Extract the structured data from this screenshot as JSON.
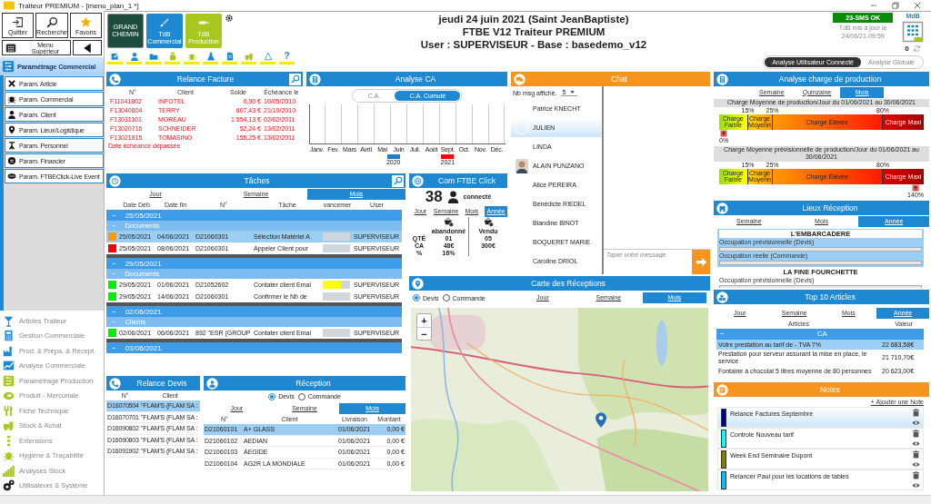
{
  "window": {
    "title": "Traiteur PREMIUM - [menu_plan_1 *]"
  },
  "sidebar": {
    "top_buttons": [
      "Quitter",
      "Recherche",
      "Favoris"
    ],
    "menu_button": "Menu Supérieur",
    "section": {
      "label": "Paramétrage Commercial",
      "expanded": true,
      "items": [
        {
          "label": "Param. Article",
          "selected": false
        },
        {
          "label": "Param. Commercial",
          "selected": false
        },
        {
          "label": "Param. Client",
          "selected": false
        },
        {
          "label": "Param. Lieux/Logistique",
          "selected": false
        },
        {
          "label": "Param. Personnel",
          "selected": false
        },
        {
          "label": "Param. Financier",
          "selected": false
        },
        {
          "label": "Param. FTBEClick-Live Event",
          "selected": false
        }
      ]
    },
    "modules": [
      {
        "label": "Articles Traiteur",
        "color": "#1e88d2"
      },
      {
        "label": "Gestion Commerciale",
        "color": "#1e88d2"
      },
      {
        "label": "Prod. & Prépa. & Récept.",
        "color": "#1e88d2"
      },
      {
        "label": "Analyse Commerciale",
        "color": "#1e88d2"
      },
      {
        "label": "Paramétrage Production",
        "color": "#a8c820"
      },
      {
        "label": "Produit - Mercuriale",
        "color": "#a8c820"
      },
      {
        "label": "Fiche Technique",
        "color": "#a8c820"
      },
      {
        "label": "Stock & Achat",
        "color": "#a8c820"
      },
      {
        "label": "Extensions",
        "color": "#a8c820"
      },
      {
        "label": "Hygiène & Traçabilité",
        "color": "#a8c820"
      },
      {
        "label": "Analyses Stock",
        "color": "#a8c820"
      },
      {
        "label": "Utilisateurs & Système",
        "color": "#222222"
      }
    ]
  },
  "header": {
    "tiles": [
      {
        "kind": "logo",
        "label": "GRAND CHEMIN"
      },
      {
        "kind": "commercial",
        "label": "TdB Commercial"
      },
      {
        "kind": "production",
        "label": "TdB Production"
      }
    ],
    "help": "?",
    "title_lines": [
      "jeudi 24 juin 2021  (Saint JeanBaptiste)",
      "FTBE V12 Traiteur PREMIUM",
      "User : SUPERVISEUR - Base : basedemo_v12"
    ],
    "sms_status": "23-SMS OK",
    "update_label": "TdB mis à jour le",
    "update_time": "24/06/21-09:59",
    "counter": "0",
    "brand": "MdB",
    "analysis_toggle": [
      {
        "label": "Analyse Utilisateur Connecté",
        "selected": true
      },
      {
        "label": "Analyse Globale",
        "selected": false
      }
    ]
  },
  "relance_facture": {
    "title": "Relance Facture",
    "columns": [
      "N°",
      "Client",
      "Solde",
      "Échéance le"
    ],
    "rows": [
      {
        "cells": [
          "F11041802",
          "INFOTEL",
          "0,90 €",
          "10/05/2010"
        ],
        "overdue": true
      },
      {
        "cells": [
          "F13040804",
          "TERRY",
          "607,43 €",
          "21/10/2010"
        ],
        "overdue": true
      },
      {
        "cells": [
          "F13031101",
          "MOREAU",
          "1 554,13 €",
          "02/02/2011"
        ],
        "overdue": true
      },
      {
        "cells": [
          "F13020716",
          "SCHNEIDER",
          "52,24 €",
          "13/02/2011"
        ],
        "overdue": true
      },
      {
        "cells": [
          "F13021815",
          "TOMASINO",
          "155,25 €",
          "13/02/2011"
        ],
        "overdue": true
      }
    ],
    "note": "Date échéance dépassée"
  },
  "analyse_ca": {
    "title": "Analyse CA",
    "toggle": [
      {
        "label": "C.A.",
        "selected": false
      },
      {
        "label": "C.A. Cumulé",
        "selected": true
      }
    ],
    "months": [
      "Janv.",
      "Fev.",
      "Mars",
      "Avril",
      "Mai",
      "Juin",
      "Juil.",
      "Août",
      "Sept.",
      "Oct.",
      "Nov.",
      "Déc."
    ],
    "legend": [
      {
        "label": "2020",
        "color": "#1e7fc8"
      },
      {
        "label": "2021",
        "color": "#ff0000"
      }
    ]
  },
  "taches": {
    "title": "Tâches",
    "tabs": [
      {
        "label": "Jour",
        "selected": false
      },
      {
        "label": "Semaine",
        "selected": false
      },
      {
        "label": "Mois",
        "selected": true
      }
    ],
    "columns": [
      "Date Déb.",
      "Date fin",
      "N°",
      "Tâche",
      "vancemer",
      "User"
    ],
    "groups": [
      {
        "toggle": "−",
        "date": "25/05/2021",
        "subgroups": [
          {
            "toggle": "−",
            "label": "Documents",
            "rows": [
              {
                "color": "#ff9900",
                "start": "25/05/2021",
                "end": "04/06/2021",
                "number": "D21060301",
                "task": "Sélection Matériel A",
                "level": 0,
                "user": "SUPERVISEUR",
                "selected": true
              },
              {
                "color": "#ff0000",
                "start": "25/05/2021",
                "end": "08/06/2021",
                "number": "D21060301",
                "task": "Appeler Client pour",
                "level": 0,
                "user": "SUPERVISEUR",
                "selected": false
              }
            ]
          }
        ]
      },
      {
        "toggle": "−",
        "date": "29/05/2021",
        "subgroups": [
          {
            "toggle": "−",
            "label": "Documents",
            "rows": [
              {
                "color": "#00ee00",
                "start": "29/05/2021",
                "end": "01/06/2021",
                "number": "D21052602",
                "task": "Contater client Emai",
                "level": 0.68,
                "user": "SUPERVISEUR",
                "selected": false
              },
              {
                "color": "#00ee00",
                "start": "29/05/2021",
                "end": "14/06/2021",
                "number": "D21060301",
                "task": "Confirmer le Nb de",
                "level": 0,
                "user": "SUPERVISEUR",
                "selected": false
              }
            ]
          }
        ]
      },
      {
        "toggle": "−",
        "date": "02/06/2021",
        "subgroups": [
          {
            "toggle": "−",
            "label": "Clients",
            "rows": [
              {
                "color": "#00ee00",
                "start": "02/06/2021",
                "end": "06/06/2021",
                "number": "892 \"ESR (GROUP",
                "task": "Contater client Emai",
                "level": 0,
                "user": "SUPERVISEUR",
                "selected": false
              }
            ]
          }
        ]
      },
      {
        "toggle": "−",
        "date": "03/06/2021"
      }
    ]
  },
  "com_ftbe": {
    "title": "Com FTBE Click",
    "connected_count": "38",
    "connected_label": "connecté",
    "tabs": [
      {
        "label": "Jour",
        "selected": false
      },
      {
        "label": "Semaine",
        "selected": false
      },
      {
        "label": "Mois",
        "selected": false
      },
      {
        "label": "Année",
        "selected": true
      }
    ],
    "row_labels": [
      "QTÉ",
      "CA",
      "%"
    ],
    "columns": [
      {
        "label": "abandonné",
        "values": [
          "01",
          "48€",
          "16%"
        ]
      },
      {
        "label": "Vendu",
        "values": [
          "05",
          "300€"
        ]
      }
    ]
  },
  "chat": {
    "title": "Chat",
    "count_label": "Nb msg affiché.",
    "count_value": "5",
    "contacts": [
      {
        "name": "Patrice KNECHT",
        "selected": false,
        "kind": "plain"
      },
      {
        "name": "JULIEN",
        "selected": true,
        "kind": "blank"
      },
      {
        "name": "LINDA",
        "selected": false,
        "kind": "plain"
      },
      {
        "name": "ALAIN PUNZANO",
        "selected": false
      },
      {
        "name": "Alice PEREIRA",
        "selected": false,
        "kind": "plain"
      },
      {
        "name": "Bénédicte RIEDEL",
        "selected": false,
        "kind": "plain"
      },
      {
        "name": "Blandine BINOT",
        "selected": false,
        "kind": "plain"
      },
      {
        "name": "BOQUERET MARIE",
        "selected": false,
        "kind": "plain"
      },
      {
        "name": "Caroline DRIOL",
        "selected": false,
        "kind": "plain"
      }
    ],
    "message_placeholder": "Taper votre message"
  },
  "carte": {
    "title": "Carte des Réceptions",
    "radios": [
      {
        "label": "Devis",
        "selected": true
      },
      {
        "label": "Commande",
        "selected": false
      }
    ],
    "tabs": [
      {
        "label": "Jour",
        "selected": false
      },
      {
        "label": "Semaine",
        "selected": false
      },
      {
        "label": "Mois",
        "selected": true
      }
    ],
    "zoom_in": "+",
    "zoom_out": "−"
  },
  "relance_devis": {
    "title": "Relance Devis",
    "columns": [
      "N°",
      "Client"
    ],
    "rows": [
      {
        "cells": [
          "D16070504",
          "\"FLAM'S (FLAM SA :"
        ],
        "selected": true
      },
      {
        "cells": [
          "D16070701",
          "\"FLAM'S (FLAM SA :"
        ],
        "selected": false
      },
      {
        "cells": [
          "D16090802",
          "\"FLAM'S (FLAM SA :"
        ],
        "selected": false
      },
      {
        "cells": [
          "D16090803",
          "\"FLAM'S (FLAM SA :"
        ],
        "selected": false
      },
      {
        "cells": [
          "D16091902",
          "\"FLAM'S (FLAM SA :"
        ],
        "selected": false
      }
    ]
  },
  "reception": {
    "title": "Réception",
    "radios": [
      {
        "label": "Devis",
        "selected": true
      },
      {
        "label": "Commande",
        "selected": false
      }
    ],
    "tabs": [
      {
        "label": "Jour",
        "selected": false
      },
      {
        "label": "Semaine",
        "selected": false
      },
      {
        "label": "Mois",
        "selected": true
      }
    ],
    "columns": [
      "N°",
      "Client",
      "Livraison",
      "Montant"
    ],
    "rows": [
      {
        "cells": [
          "D21060101",
          "A+ GLASS",
          "01/06/2021",
          "0,00 €"
        ],
        "selected": true
      },
      {
        "cells": [
          "D21060102",
          "AEDIAN",
          "01/06/2021",
          "0,00 €"
        ],
        "selected": false
      },
      {
        "cells": [
          "D21060103",
          "AEGIDE",
          "01/06/2021",
          "0,00 €"
        ],
        "selected": false
      },
      {
        "cells": [
          "D21060104",
          "AG2R LA MONDIALE",
          "01/06/2021",
          "0,00 €"
        ],
        "selected": false
      }
    ]
  },
  "charge": {
    "title": "Analyse charge de production",
    "tabs": [
      {
        "label": "Semaine",
        "selected": false
      },
      {
        "label": "Quinzaine",
        "selected": false
      },
      {
        "label": "Mois",
        "selected": true
      }
    ],
    "gauges": [
      {
        "caption": "Charge Moyenne de production/Jour du 01/06/2021 au 30/06/2021",
        "ticks": [
          "15%",
          "25%",
          "80%"
        ],
        "zones": [
          "Charge Faible",
          "Charge Moyenn",
          "Charge Élevée",
          "Charge Maxi"
        ],
        "marker": {
          "label": "0%",
          "level": 0
        }
      },
      {
        "caption": "Charge Moyenne prévisionnelle de production/Jour du 01/06/2021 au 30/06/2021",
        "ticks": [
          "15%",
          "25%",
          "80%"
        ],
        "zones": [
          "Charge Faible",
          "Charge Moyenn",
          "Charge Élevée",
          "Charge Maxi"
        ],
        "marker": {
          "label": "140%",
          "level": 1
        }
      }
    ]
  },
  "lieux": {
    "title": "Lieux  Réception",
    "tabs": [
      {
        "label": "Semaine",
        "selected": false
      },
      {
        "label": "Mois",
        "selected": false
      },
      {
        "label": "Année",
        "selected": true
      }
    ],
    "venues": [
      {
        "name": "L'EMBARCADERE",
        "selected": true,
        "occupancy": [
          "Occupation prévisionnelle (Devis)",
          "Occupation réelle (Commande)"
        ]
      },
      {
        "name": "LA FINE FOURCHETTE",
        "selected": false,
        "occupancy": [
          "Occupation prévisionnelle (Devis)"
        ]
      }
    ]
  },
  "top10": {
    "title": "Top 10 Articles",
    "tabs": [
      {
        "label": "Jour",
        "selected": false
      },
      {
        "label": "Semaine",
        "selected": false
      },
      {
        "label": "Mois",
        "selected": false
      },
      {
        "label": "Année",
        "selected": true
      }
    ],
    "columns": [
      "Articles",
      "Valeur"
    ],
    "group": {
      "toggle": "−",
      "label": "CA"
    },
    "rows": [
      {
        "article": "Votre prestation au tarif de - TVA 7%",
        "value": "22 683,58€",
        "selected": true
      },
      {
        "article": "Prestation pour serveur assurant la mise en place, le service",
        "value": "21 710,70€",
        "selected": false
      },
      {
        "article": "Fontaine à chocolat 5 litres moyenne de 80 personnes",
        "value": "20 623,00€",
        "selected": false
      }
    ]
  },
  "notes": {
    "title": "Notes",
    "add_link": "+ Ajouter une Note",
    "items": [
      {
        "text": "Relance Factures Septembre",
        "color": "#000080",
        "selected": true
      },
      {
        "text": "Controle Nouveau tarif",
        "color": "#00ffff",
        "selected": false
      },
      {
        "text": "Week End Séminaire Dupont",
        "color": "#808000",
        "selected": false
      },
      {
        "text": "Relancer Paul pour les locations de tables",
        "color": "#00bfff",
        "selected": false
      }
    ]
  }
}
